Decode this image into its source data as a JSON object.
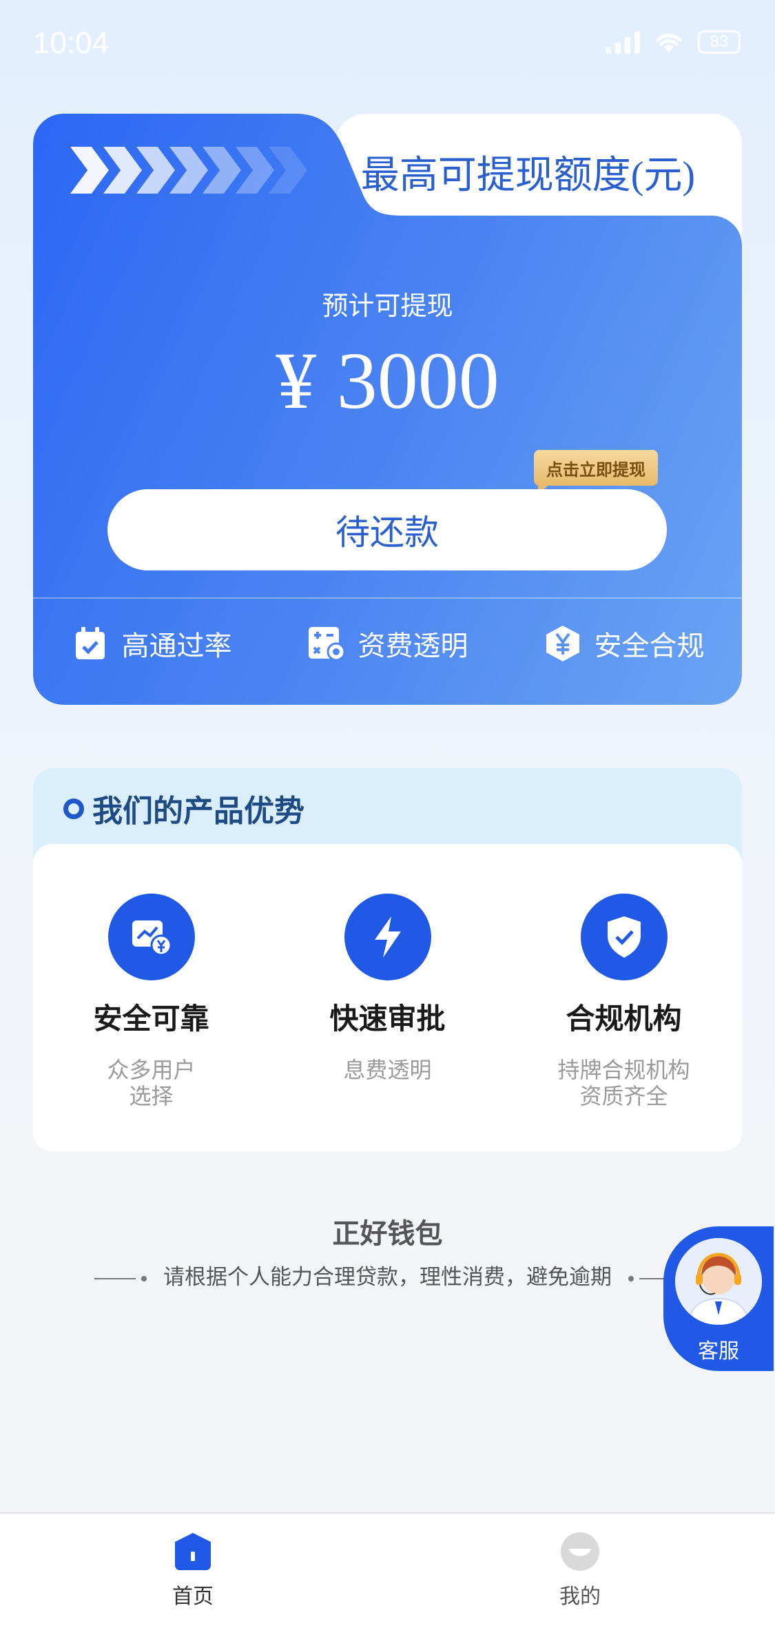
{
  "status_bar": {
    "time": "10:04",
    "battery": "83"
  },
  "hero": {
    "tab_title": "最高可提现额度(元)",
    "subtitle": "预计可提现",
    "amount": "¥ 3000",
    "badge": "点击立即提现",
    "button_label": "待还款",
    "features": [
      {
        "label": "高通过率",
        "icon": "calendar-check-icon"
      },
      {
        "label": "资费透明",
        "icon": "calculator-icon"
      },
      {
        "label": "安全合规",
        "icon": "yuan-shield-icon"
      }
    ]
  },
  "advantages": {
    "title": "我们的产品优势",
    "items": [
      {
        "name": "安全可靠",
        "desc": "众多用户\n选择",
        "icon": "chart-yuan-icon"
      },
      {
        "name": "快速审批",
        "desc": "息费透明",
        "icon": "lightning-icon"
      },
      {
        "name": "合规机构",
        "desc": "持牌合规机构\n资质齐全",
        "icon": "shield-check-icon"
      }
    ]
  },
  "footer": {
    "brand": "正好钱包",
    "slogan": "请根据个人能力合理贷款，理性消费，避免逾期"
  },
  "customer_service": {
    "label": "客服"
  },
  "bottom_nav": {
    "items": [
      {
        "label": "首页",
        "active": true
      },
      {
        "label": "我的",
        "active": false
      }
    ]
  },
  "colors": {
    "primary": "#2059e6",
    "hero_gradient_end": "#6aa4f4",
    "badge_gold": "#e8b96b"
  }
}
